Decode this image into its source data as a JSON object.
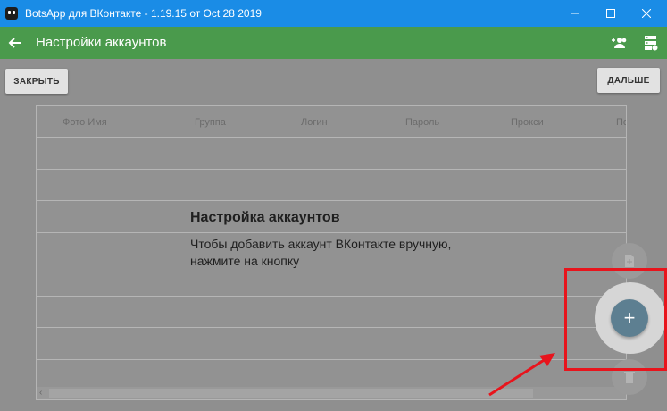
{
  "window": {
    "title": "BotsApp для ВКонтакте - 1.19.15 от Oct 28 2019"
  },
  "appbar": {
    "title": "Настройки аккаунтов"
  },
  "buttons": {
    "close_label": "ЗАКРЫТЬ",
    "next_label": "ДАЛЬШЕ"
  },
  "table": {
    "columns": [
      "Фото Имя",
      "Группа",
      "Логин",
      "Пароль",
      "Прокси",
      "По"
    ]
  },
  "empty_state": {
    "title": "Настройка аккаунтов",
    "text": "Чтобы добавить аккаунт ВКонтакте вручную,\n нажмите на кнопку"
  },
  "fab": {
    "add_symbol": "+"
  },
  "icons": [
    "app-icon",
    "minimize-icon",
    "maximize-icon",
    "close-icon",
    "back-arrow-icon",
    "add-user-icon",
    "servers-icon",
    "file-icon",
    "add-icon",
    "trash-icon"
  ],
  "colors": {
    "titlebar": "#1a8ce6",
    "appbar": "#4a9a4c",
    "fab": "#5d7f91",
    "annotation": "#e8141c"
  }
}
